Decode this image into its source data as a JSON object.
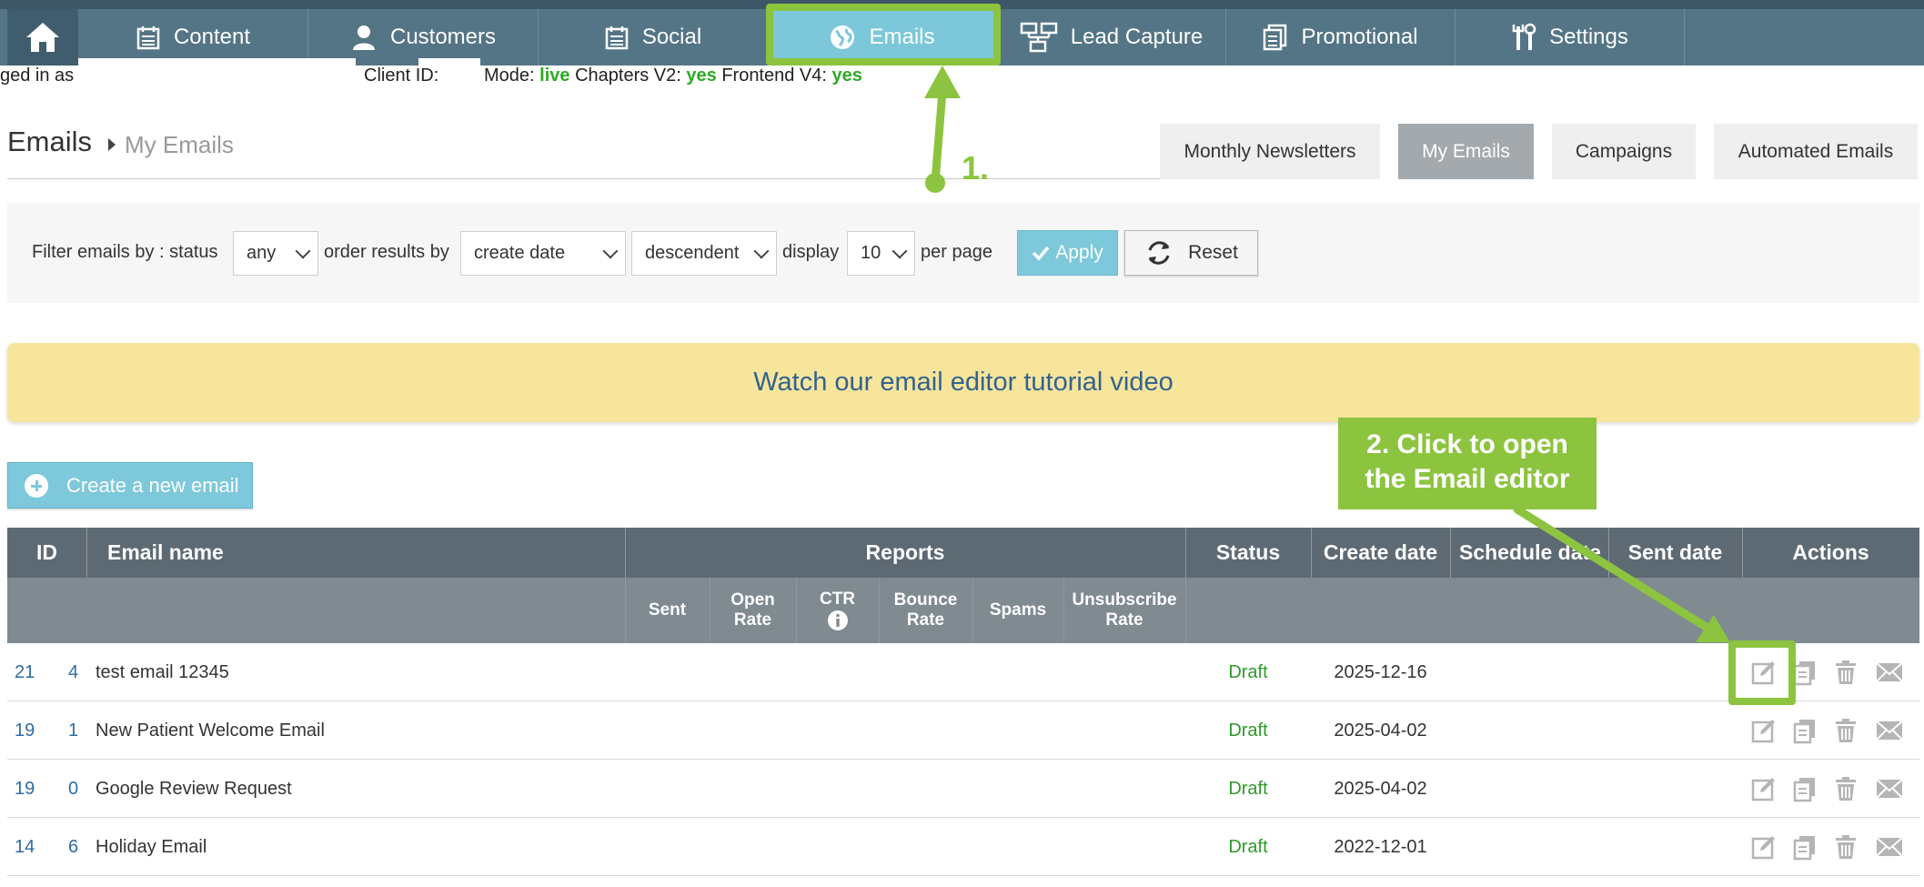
{
  "nav": {
    "items": [
      {
        "label": "Content",
        "icon": "calendar-icon"
      },
      {
        "label": "Customers",
        "icon": "person-icon"
      },
      {
        "label": "Social",
        "icon": "calendar-icon"
      },
      {
        "label": "Emails",
        "icon": "globe-icon",
        "active": true
      },
      {
        "label": "Lead Capture",
        "icon": "sitemap-icon"
      },
      {
        "label": "Promotional",
        "icon": "copy-icon"
      },
      {
        "label": "Settings",
        "icon": "tools-icon"
      }
    ]
  },
  "subheader": {
    "logged_in": "ged in as",
    "client_id": "Client ID:",
    "mode_label": "Mode:",
    "mode_value": "live",
    "chapters_label": "Chapters V2:",
    "chapters_value": "yes",
    "frontend_label": "Frontend V4:",
    "frontend_value": "yes"
  },
  "breadcrumb": {
    "title": "Emails",
    "current": "My Emails"
  },
  "tabs": [
    {
      "label": "Monthly Newsletters"
    },
    {
      "label": "My Emails",
      "active": true
    },
    {
      "label": "Campaigns"
    },
    {
      "label": "Automated Emails"
    }
  ],
  "filter": {
    "prefix": "Filter emails by : status",
    "status": "any",
    "order_label": "order results by",
    "order_by": "create date",
    "direction": "descendent",
    "display_label": "display",
    "per_page": "10",
    "per_page_label": "per page",
    "apply": "Apply",
    "reset": "Reset"
  },
  "banner": "Watch our email editor tutorial video",
  "create_button": "Create a new email",
  "table": {
    "headers": {
      "id": "ID",
      "name": "Email name",
      "reports": "Reports",
      "status": "Status",
      "create_date": "Create date",
      "schedule_date": "Schedule date",
      "sent_date": "Sent date",
      "actions": "Actions"
    },
    "subheaders": {
      "sent": "Sent",
      "open_rate_1": "Open",
      "open_rate_2": "Rate",
      "ctr": "CTR",
      "bounce_rate_1": "Bounce",
      "bounce_rate_2": "Rate",
      "spams": "Spams",
      "unsub_1": "Unsubscribe",
      "unsub_2": "Rate"
    },
    "rows": [
      {
        "id_start": "21",
        "id_end": "4",
        "name": "test email 12345",
        "status": "Draft",
        "create_date": "2025-12-16"
      },
      {
        "id_start": "19",
        "id_end": "1",
        "name": "New Patient Welcome Email",
        "status": "Draft",
        "create_date": "2025-04-02"
      },
      {
        "id_start": "19",
        "id_end": "0",
        "name": "Google Review Request",
        "status": "Draft",
        "create_date": "2025-04-02"
      },
      {
        "id_start": "14",
        "id_end": "6",
        "name": "Holiday Email",
        "status": "Draft",
        "create_date": "2022-12-01"
      }
    ]
  },
  "annotations": {
    "step1": "1.",
    "step2_line1": "2. Click to open",
    "step2_line2": "the Email editor",
    "color": "#8cc43f"
  },
  "colors": {
    "nav_bg": "#547585",
    "nav_active": "#7cc7d9",
    "accent_button": "#7dc8db",
    "banner_bg": "#f6e59b",
    "draft_green": "#2e9a29",
    "table_header": "#5d6a73"
  }
}
